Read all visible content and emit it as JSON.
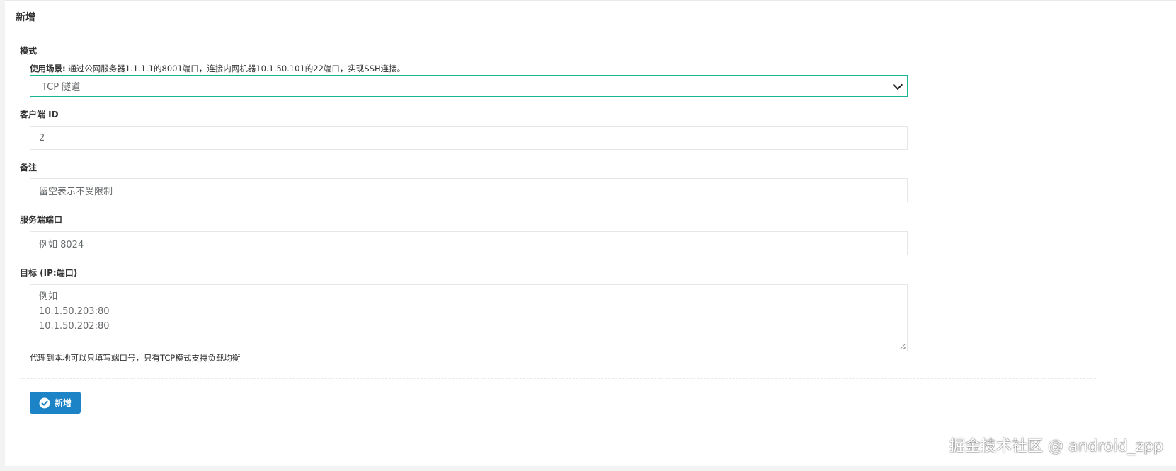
{
  "panel": {
    "title": "新增"
  },
  "mode": {
    "label": "模式",
    "hint_prefix": "使用场景:",
    "hint_text": " 通过公网服务器1.1.1.1的8001端口，连接内网机器10.1.50.101的22端口，实现SSH连接。",
    "selected": "TCP 隧道"
  },
  "client_id": {
    "label": "客户端 ID",
    "value": "2"
  },
  "remark": {
    "label": "备注",
    "placeholder": "留空表示不受限制"
  },
  "server_port": {
    "label": "服务端端口",
    "placeholder": "例如 8024"
  },
  "target": {
    "label": "目标 (IP:端口)",
    "placeholder_lines": [
      "例如",
      "10.1.50.203:80",
      "10.1.50.202:80"
    ],
    "help": "代理到本地可以只填写端口号，只有TCP模式支持负载均衡"
  },
  "submit": {
    "label": "新增"
  },
  "watermark": "掘金技术社区 @ android_zpp"
}
